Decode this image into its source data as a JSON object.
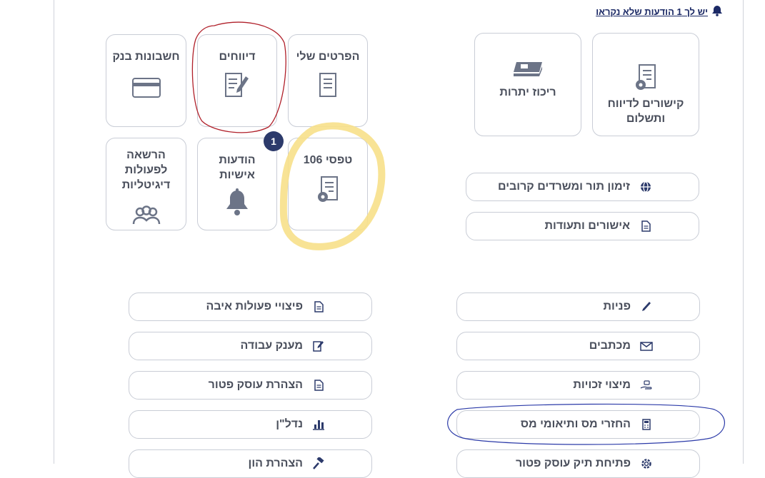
{
  "notice": {
    "text": "יש לך 1 הודעות שלא נקראו"
  },
  "tiles": {
    "bank_accounts": "חשבונות בנק",
    "reports": "דיווחים",
    "my_details": "הפרטים שלי",
    "authorization_line1": "הרשאה",
    "authorization_line2": "לפעולות",
    "authorization_line3": "דיגיטליות",
    "messages_line1": "הודעות",
    "messages_line2": "אישיות",
    "messages_badge": "1",
    "form106": "טפסי 106",
    "balance": "ריכוז יתרות",
    "links_line1": "קישורים לדיווח",
    "links_line2": "ותשלום"
  },
  "pills": {
    "appointment": "זימון תור ומשרדים קרובים",
    "certificates": "אישורים ותעודות",
    "inquiries": "פניות",
    "hostile_compensation": "פיצויי פעולות איבה",
    "letters": "מכתבים",
    "work_grant": "מענק עבודה",
    "rights": "מיצוי זכויות",
    "exempt_dealer_declaration": "הצהרת עוסק פטור",
    "tax_refunds": "החזרי מס ותיאומי מס",
    "real_estate": "נדל\"ן",
    "open_exempt_file": "פתיחת תיק עוסק פטור",
    "capital_declaration": "הצהרת הון"
  },
  "colors": {
    "icon": "#6c7487",
    "navy": "#2c3a6b",
    "border": "#c9cdd6",
    "red_mark": "#b0202a",
    "yellow_mark": "#f7e08a",
    "blue_mark": "#2b3aa8"
  }
}
